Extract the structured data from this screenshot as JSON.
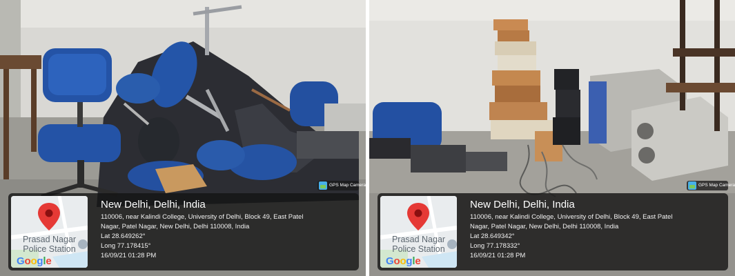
{
  "photos": [
    {
      "location_title": "New Delhi, Delhi, India",
      "address_line1": "110006, near Kalindi College, University of Delhi, Block 49, East Patel",
      "address_line2": "Nagar, Patel Nagar, New Delhi, Delhi 110008, India",
      "lat": "Lat 28.649262°",
      "long": "Long 77.178415°",
      "timestamp": "16/09/21 01:28 PM",
      "map_place_line1": "Prasad Nagar",
      "map_place_line2": "Police Station",
      "map_brand": "Google",
      "app_badge": "GPS Map Camera",
      "map_pin_icon": "location-pin-icon",
      "colors": {
        "pin": "#e53935",
        "overlay": "#141414"
      }
    },
    {
      "location_title": "New Delhi, Delhi, India",
      "address_line1": "110006, near Kalindi College, University of Delhi, Block 49, East Patel",
      "address_line2": "Nagar, Patel Nagar, New Delhi, Delhi 110008, India",
      "lat": "Lat 28.649342°",
      "long": "Long 77.178332°",
      "timestamp": "16/09/21 01:28 PM",
      "map_place_line1": "Prasad Nagar",
      "map_place_line2": "Police Station",
      "map_brand": "Google",
      "app_badge": "GPS Map Camera",
      "map_pin_icon": "location-pin-icon",
      "colors": {
        "pin": "#e53935",
        "overlay": "#141414"
      }
    }
  ]
}
